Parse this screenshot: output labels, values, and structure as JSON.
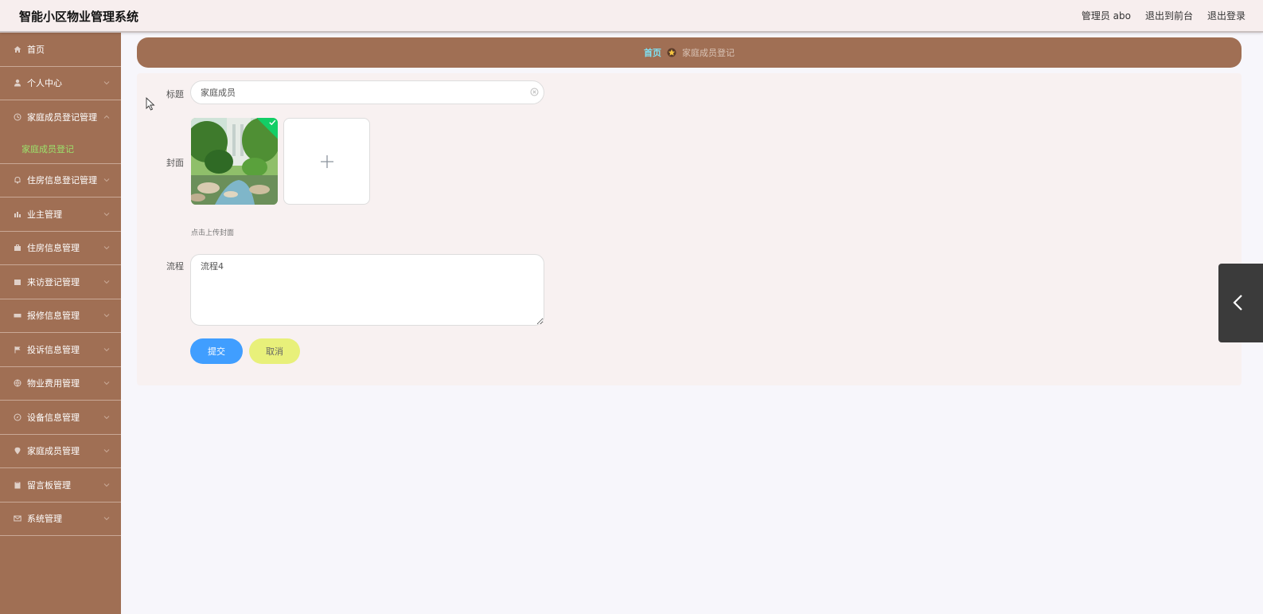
{
  "header": {
    "title": "智能小区物业管理系统",
    "user_label": "管理员 abo",
    "to_front_label": "退出到前台",
    "logout_label": "退出登录"
  },
  "sidebar": {
    "items": [
      {
        "label": "首页",
        "icon": "home-icon"
      },
      {
        "label": "个人中心",
        "icon": "user-icon"
      },
      {
        "label": "家庭成员登记管理",
        "icon": "clock-icon",
        "expanded": true,
        "children": [
          {
            "label": "家庭成员登记"
          }
        ]
      },
      {
        "label": "住房信息登记管理",
        "icon": "bell-icon"
      },
      {
        "label": "业主管理",
        "icon": "chart-icon"
      },
      {
        "label": "住房信息管理",
        "icon": "briefcase-icon"
      },
      {
        "label": "来访登记管理",
        "icon": "calendar-icon"
      },
      {
        "label": "报修信息管理",
        "icon": "ticket-icon"
      },
      {
        "label": "投诉信息管理",
        "icon": "flag-icon"
      },
      {
        "label": "物业费用管理",
        "icon": "globe-icon"
      },
      {
        "label": "设备信息管理",
        "icon": "compass-icon"
      },
      {
        "label": "家庭成员管理",
        "icon": "location-icon"
      },
      {
        "label": "留言板管理",
        "icon": "clipboard-icon"
      },
      {
        "label": "系统管理",
        "icon": "mail-icon"
      }
    ],
    "active_color": "#9be36b"
  },
  "breadcrumb": {
    "home": "首页",
    "current": "家庭成员登记"
  },
  "form": {
    "title_label": "标题",
    "title_value": "家庭成员",
    "cover_label": "封面",
    "upload_hint": "点击上传封面",
    "process_label": "流程",
    "process_value": "流程4",
    "submit_label": "提交",
    "cancel_label": "取消"
  },
  "colors": {
    "sidebar_bg": "#a06f54",
    "primary": "#409eff",
    "cancel": "#e8f07a",
    "success": "#13ce66"
  }
}
